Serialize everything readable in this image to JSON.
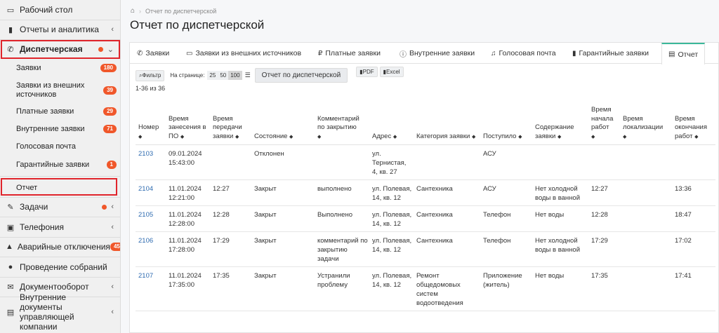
{
  "sidebar": {
    "items": [
      {
        "icon": "monitor-icon",
        "label": "Рабочий стол"
      },
      {
        "icon": "bar-chart-icon",
        "label": "Отчеты и аналитика"
      },
      {
        "icon": "phone-icon",
        "label": "Диспетчерская"
      }
    ],
    "dispatch_sub": [
      {
        "label": "Заявки",
        "badge": "180"
      },
      {
        "label": "Заявки из внешних источников",
        "badge": "39"
      },
      {
        "label": "Платные заявки",
        "badge": "29"
      },
      {
        "label": "Внутренние заявки",
        "badge": "71"
      },
      {
        "label": "Голосовая почта",
        "badge": ""
      },
      {
        "label": "Гарантийные заявки",
        "badge": "1"
      },
      {
        "label": "Отчет",
        "badge": ""
      }
    ],
    "bottom_items": [
      {
        "icon": "edit-icon",
        "label": "Задачи"
      },
      {
        "icon": "phone-square-icon",
        "label": "Телефония"
      },
      {
        "icon": "warning-icon",
        "label": "Аварийные отключения",
        "badge": "45"
      },
      {
        "icon": "users-icon",
        "label": "Проведение собраний"
      },
      {
        "icon": "envelope-icon",
        "label": "Документооборот"
      },
      {
        "icon": "document-icon",
        "label": "Внутренние документы управляющей компании"
      }
    ],
    "colors": {
      "accent": "#f0572a",
      "highlight": "#e0242b"
    }
  },
  "breadcrumb": {
    "current": "Отчет по диспетчерской"
  },
  "page_title": "Отчет по диспетчерской",
  "tabs": [
    {
      "icon": "phone-icon",
      "label": "Заявки"
    },
    {
      "icon": "inbox-icon",
      "label": "Заявки из внешних источников"
    },
    {
      "icon": "ruble-icon",
      "label": "Платные заявки"
    },
    {
      "icon": "info-icon",
      "label": "Внутренние заявки"
    },
    {
      "icon": "headphones-icon",
      "label": "Голосовая почта"
    },
    {
      "icon": "book-icon",
      "label": "Гарантийные заявки"
    },
    {
      "icon": "report-icon",
      "label": "Отчет"
    }
  ],
  "toolbar": {
    "filter": "Фильтр",
    "per_page_label": "На странице:",
    "per_page": [
      "25",
      "50",
      "100"
    ],
    "report_button": "Отчет по диспетчерской",
    "pdf": "PDF",
    "excel": "Excel",
    "count": "1-36 из 36"
  },
  "table": {
    "headers": [
      "Номер",
      "Время занесения в ПО",
      "Время передачи заявки",
      "Состояние",
      "Комментарий по закрытию",
      "Адрес",
      "Категория заявки",
      "Поступило",
      "Содержание заявки",
      "Время начала работ",
      "Время локализации",
      "Время окончания работ"
    ],
    "rows": [
      [
        "2103",
        "09.01.2024 15:43:00",
        "",
        "Отклонен",
        "",
        "ул. Тернистая, 4, кв. 27",
        "",
        "АСУ",
        "",
        "",
        "",
        ""
      ],
      [
        "2104",
        "11.01.2024 12:21:00",
        "12:27",
        "Закрыт",
        "выполнено",
        "ул. Полевая, 14, кв. 12",
        "Сантехника",
        "АСУ",
        "Нет холодной воды в ванной",
        "12:27",
        "",
        "13:36"
      ],
      [
        "2105",
        "11.01.2024 12:28:00",
        "12:28",
        "Закрыт",
        "Выполнено",
        "ул. Полевая, 14, кв. 12",
        "Сантехника",
        "Телефон",
        "Нет воды",
        "12:28",
        "",
        "18:47"
      ],
      [
        "2106",
        "11.01.2024 17:28:00",
        "17:29",
        "Закрыт",
        "комментарий по закрытию задачи",
        "ул. Полевая, 14, кв. 12",
        "Сантехника",
        "Телефон",
        "Нет холодной воды в ванной",
        "17:29",
        "",
        "17:02"
      ],
      [
        "2107",
        "11.01.2024 17:35:00",
        "17:35",
        "Закрыт",
        "Устранили проблему",
        "ул. Полевая, 14, кв. 12",
        "Ремонт общедомовых систем водоотведения",
        "Приложение (житель)",
        "Нет воды",
        "17:35",
        "",
        "17:41"
      ]
    ]
  }
}
